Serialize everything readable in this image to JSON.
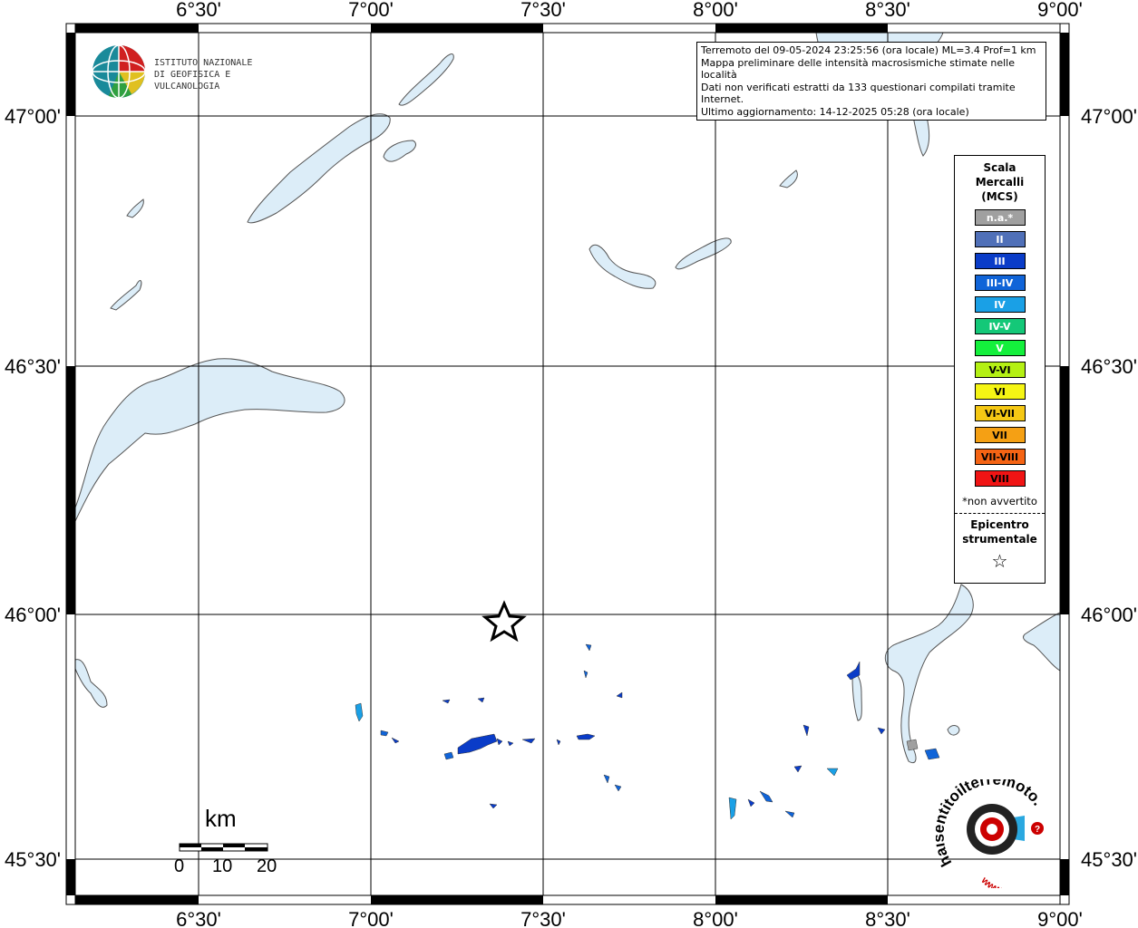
{
  "map": {
    "lon_ticks": [
      "6°30'",
      "7°00'",
      "7°30'",
      "8°00'",
      "8°30'",
      "9°00'"
    ],
    "lat_ticks": [
      "47°00'",
      "46°30'",
      "46°00'",
      "45°30'"
    ],
    "epicenter": {
      "lat": 45.98,
      "lon": 7.24
    }
  },
  "info": {
    "line1": "Terremoto del 09-05-2024 23:25:56 (ora locale) ML=3.4 Prof=1 km",
    "line2": "Mappa preliminare delle intensità macrosismiche stimate nelle località",
    "line3": "Dati non verificati estratti da 133 questionari compilati tramite Internet.",
    "line4": "Ultimo aggiornamento: 14-12-2025 05:28 (ora locale)"
  },
  "logo": {
    "line1": "ISTITUTO NAZIONALE",
    "line2": "DI GEOFISICA E VULCANOLOGIA"
  },
  "legend": {
    "title_line1": "Scala",
    "title_line2": "Mercalli",
    "title_line3": "(MCS)",
    "items": [
      {
        "label": "n.a.*",
        "color": "#a0a0a0"
      },
      {
        "label": "II",
        "color": "#5070b8"
      },
      {
        "label": "III",
        "color": "#0a3cc8"
      },
      {
        "label": "III-IV",
        "color": "#1064d8"
      },
      {
        "label": "IV",
        "color": "#1aa0e6"
      },
      {
        "label": "IV-V",
        "color": "#14c878"
      },
      {
        "label": "V",
        "color": "#14f03c"
      },
      {
        "label": "V-VI",
        "color": "#b4f014"
      },
      {
        "label": "VI",
        "color": "#f5f514"
      },
      {
        "label": "VI-VII",
        "color": "#f5c814"
      },
      {
        "label": "VII",
        "color": "#f5a014"
      },
      {
        "label": "VII-VIII",
        "color": "#f56414"
      },
      {
        "label": "VIII",
        "color": "#f01414"
      }
    ],
    "note": "*non avvertito",
    "epicenter_line1": "Epicentro",
    "epicenter_line2": "strumentale",
    "star": "☆"
  },
  "scalebar": {
    "unit": "km",
    "labels": [
      "0",
      "10",
      "20"
    ]
  },
  "hs_logo": {
    "text_outer": "haisentitoilterremoto.it",
    "text_www": "www.",
    "q": "?"
  }
}
